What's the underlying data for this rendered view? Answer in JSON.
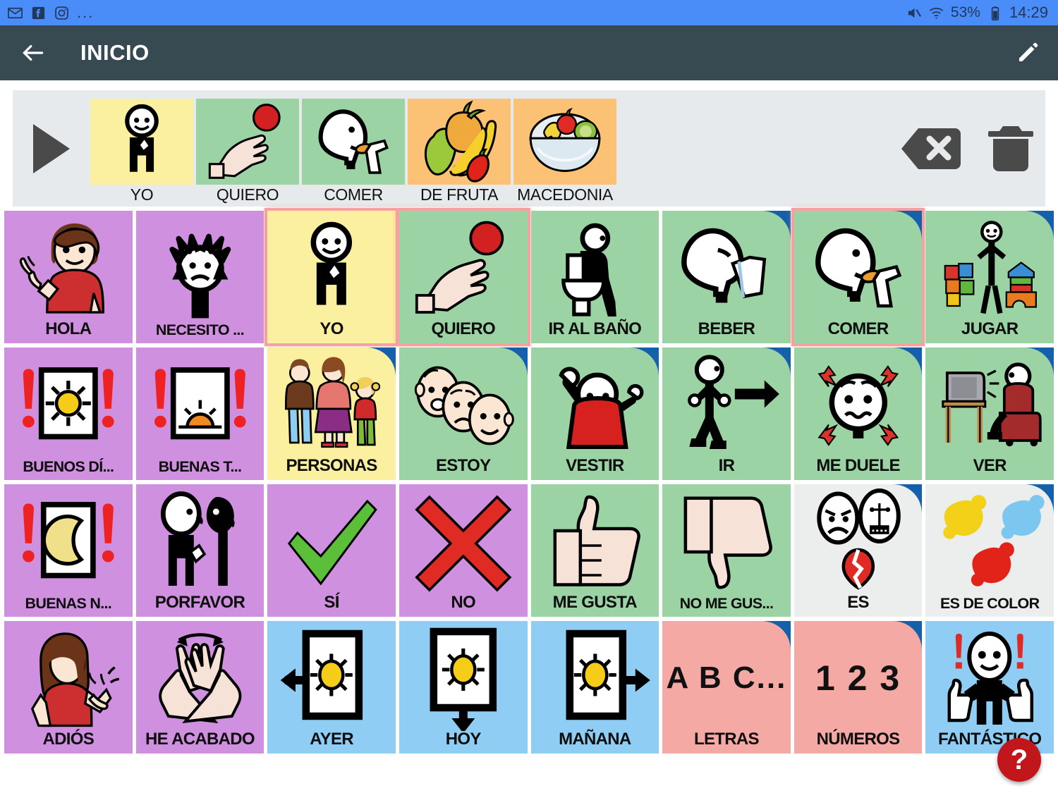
{
  "status_bar": {
    "background": "#4b8df8",
    "app_icons": [
      "gmail-icon",
      "facebook-icon",
      "instagram-icon"
    ],
    "overflow": "...",
    "mute_icon": "volume-muted-icon",
    "wifi_icon": "wifi-icon",
    "battery_pct": "53%",
    "battery_icon": "battery-icon",
    "clock": "14:29"
  },
  "app_bar": {
    "background": "#374a52",
    "back_icon": "back-arrow-icon",
    "title": "INICIO",
    "edit_icon": "pencil-icon"
  },
  "sentence_bar": {
    "background": "#e6eaec",
    "play_icon": "play-icon",
    "backspace_icon": "backspace-icon",
    "delete_icon": "trash-icon",
    "items": [
      {
        "label": "YO",
        "color": "#faf0a0",
        "pic": "person-self"
      },
      {
        "label": "QUIERO",
        "color": "#9bd3a5",
        "pic": "hand-ball"
      },
      {
        "label": "COMER",
        "color": "#9bd3a5",
        "pic": "head-eat"
      },
      {
        "label": "DE FRUTA",
        "color": "#fbc175",
        "pic": "fruits"
      },
      {
        "label": "MACEDONIA",
        "color": "#fbc175",
        "pic": "fruit-bowl"
      }
    ]
  },
  "grid": {
    "columns": 8,
    "rows": 4,
    "colors": {
      "purple": "#cf90e0",
      "yellow": "#faf0a0",
      "green": "#9bd3a5",
      "blue": "#8fcdf5",
      "pink": "#f4a9a4",
      "gray": "#eceeed",
      "corner_blue": "#1560ab",
      "selection": "#f6a0a0"
    },
    "tiles": [
      {
        "label": "HOLA",
        "color": "purple",
        "pic": "girl-waving",
        "corner": false,
        "selected": false
      },
      {
        "label": "NECESITO ...",
        "color": "purple",
        "pic": "person-need",
        "corner": false,
        "selected": false
      },
      {
        "label": "YO",
        "color": "yellow",
        "pic": "person-self",
        "corner": false,
        "selected": true
      },
      {
        "label": "QUIERO",
        "color": "green",
        "pic": "hand-ball",
        "corner": false,
        "selected": true
      },
      {
        "label": "IR AL BAÑO",
        "color": "green",
        "pic": "toilet",
        "corner": false,
        "selected": false
      },
      {
        "label": "BEBER",
        "color": "green",
        "pic": "head-drink",
        "corner": true,
        "selected": false
      },
      {
        "label": "COMER",
        "color": "green",
        "pic": "head-eat",
        "corner": true,
        "selected": true
      },
      {
        "label": "JUGAR",
        "color": "green",
        "pic": "play-toys",
        "corner": true,
        "selected": false
      },
      {
        "label": "BUENOS DÍ...",
        "color": "purple",
        "pic": "sun-window",
        "corner": false,
        "selected": false
      },
      {
        "label": "BUENAS T...",
        "color": "purple",
        "pic": "sunset-window",
        "corner": false,
        "selected": false
      },
      {
        "label": "PERSONAS",
        "color": "yellow",
        "pic": "family",
        "corner": true,
        "selected": false
      },
      {
        "label": "ESTOY",
        "color": "green",
        "pic": "faces-moods",
        "corner": true,
        "selected": false
      },
      {
        "label": "VESTIR",
        "color": "green",
        "pic": "dressing",
        "corner": true,
        "selected": false
      },
      {
        "label": "IR",
        "color": "green",
        "pic": "walking-arrow",
        "corner": true,
        "selected": false
      },
      {
        "label": "ME DUELE",
        "color": "green",
        "pic": "face-pain",
        "corner": true,
        "selected": false
      },
      {
        "label": "VER",
        "color": "green",
        "pic": "tv-watching",
        "corner": true,
        "selected": false
      },
      {
        "label": "BUENAS N...",
        "color": "purple",
        "pic": "moon-window",
        "corner": false,
        "selected": false
      },
      {
        "label": "PORFAVOR",
        "color": "purple",
        "pic": "two-people-asking",
        "corner": false,
        "selected": false
      },
      {
        "label": "SÍ",
        "color": "purple",
        "pic": "green-check",
        "corner": false,
        "selected": false
      },
      {
        "label": "NO",
        "color": "purple",
        "pic": "red-cross",
        "corner": false,
        "selected": false
      },
      {
        "label": "ME GUSTA",
        "color": "green",
        "pic": "thumb-up",
        "corner": false,
        "selected": false
      },
      {
        "label": "NO ME GUS...",
        "color": "green",
        "pic": "thumb-down",
        "corner": false,
        "selected": false
      },
      {
        "label": "ES",
        "color": "gray",
        "pic": "faces-broken-heart",
        "corner": true,
        "selected": false
      },
      {
        "label": "ES DE COLOR",
        "color": "gray",
        "pic": "paint-splats",
        "corner": true,
        "selected": false
      },
      {
        "label": "ADIÓS",
        "color": "purple",
        "pic": "girl-goodbye",
        "corner": false,
        "selected": false
      },
      {
        "label": "HE ACABADO",
        "color": "purple",
        "pic": "crossed-hands",
        "corner": false,
        "selected": false
      },
      {
        "label": "AYER",
        "color": "blue",
        "pic": "sun-left-arrow",
        "corner": false,
        "selected": false
      },
      {
        "label": "HOY",
        "color": "blue",
        "pic": "sun-down-arrow",
        "corner": false,
        "selected": false
      },
      {
        "label": "MAÑANA",
        "color": "blue",
        "pic": "sun-right-arrow",
        "corner": false,
        "selected": false
      },
      {
        "label": "LETRAS",
        "color": "pink",
        "pic": "abc-text",
        "corner": true,
        "selected": false
      },
      {
        "label": "NÚMEROS",
        "color": "pink",
        "pic": "123-text",
        "corner": true,
        "selected": false
      },
      {
        "label": "FANTÁSTICO",
        "color": "blue",
        "pic": "two-thumbs-up",
        "corner": false,
        "selected": false
      }
    ]
  },
  "help_fab": {
    "label": "?",
    "color": "#c0161c"
  },
  "pictogram_text": {
    "abc-text": "A B C...",
    "123-text": "1 2 3"
  }
}
